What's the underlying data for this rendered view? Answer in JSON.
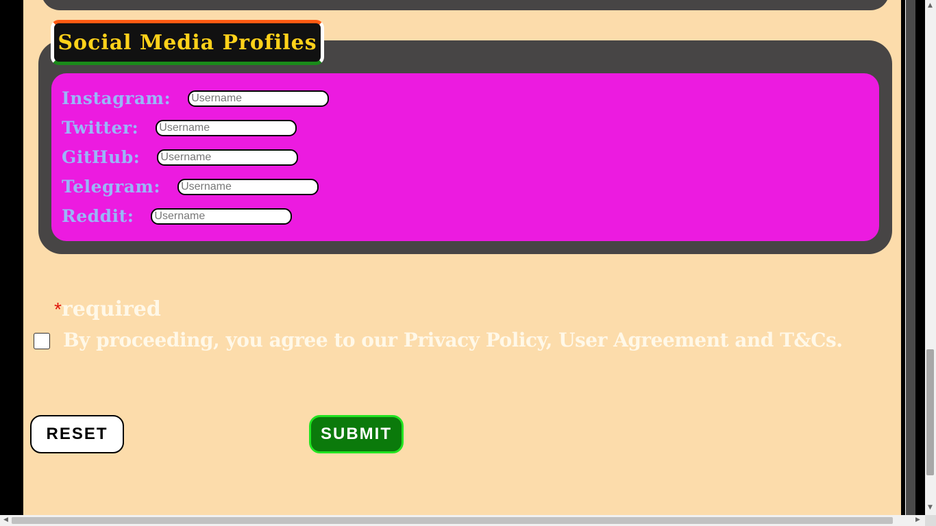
{
  "social": {
    "legend": "Social Media Profiles",
    "fields": [
      {
        "label": "Instagram:",
        "placeholder": "Username"
      },
      {
        "label": "Twitter:",
        "placeholder": "Username"
      },
      {
        "label": "GitHub:",
        "placeholder": "Username"
      },
      {
        "label": "Telegram:",
        "placeholder": "Username"
      },
      {
        "label": "Reddit:",
        "placeholder": "Username"
      }
    ]
  },
  "required_note": {
    "star": "*",
    "text": "required"
  },
  "agreement": {
    "text": "By proceeding, you agree to our Privacy Policy, User Agreement and T&Cs.",
    "checked": false
  },
  "buttons": {
    "reset": "RESET",
    "submit": "SUBMIT"
  },
  "scrollbar_icons": {
    "up": "scroll-up-arrow",
    "down": "scroll-down-arrow",
    "left": "scroll-left-arrow",
    "right": "scroll-right-arrow"
  },
  "colors": {
    "page_bg": "#fcdcab",
    "fieldset_bg": "#474545",
    "inner_panel": "#ec1be0",
    "legend_text": "#ffd21a",
    "label_text": "#9ab6f7",
    "submit_bg": "#0b7a0b"
  }
}
